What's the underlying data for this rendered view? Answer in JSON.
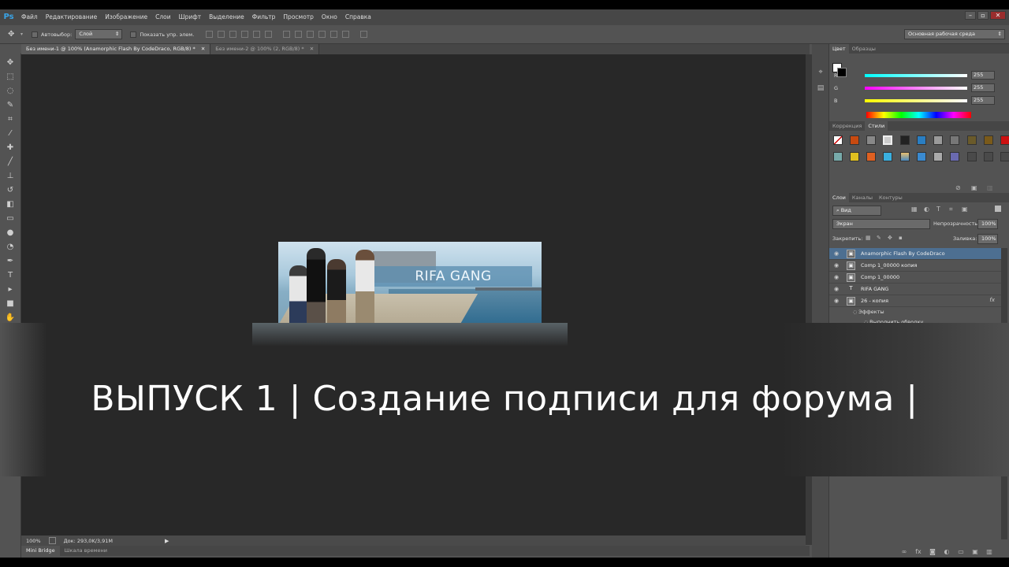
{
  "app": {
    "logo": "Ps",
    "menu": [
      "Файл",
      "Редактирование",
      "Изображение",
      "Слои",
      "Шрифт",
      "Выделение",
      "Фильтр",
      "Просмотр",
      "Окно",
      "Справка"
    ],
    "window_buttons": [
      "–",
      "▫",
      "✕"
    ]
  },
  "options": {
    "autoselect_label": "Автовыбор:",
    "autoselect_value": "Слой",
    "show_controls_label": "Показать упр. элем.",
    "workspace": "Основная рабочая среда"
  },
  "doc_tabs": [
    {
      "label": "Без имени-1 @ 100% (Anamorphic Flash By CodeDraco, RGB/8) *",
      "close": "✕"
    },
    {
      "label": "Без имени-2 @ 100% (2, RGB/8) *",
      "close": "✕"
    }
  ],
  "canvas": {
    "banner_text": "RIFA GANG"
  },
  "overlay": {
    "title": "ВЫПУСК 1 | Создание подписи для форума |"
  },
  "status": {
    "zoom": "100%",
    "doc_info": "Док: 293,0K/3,91M"
  },
  "bottom_tabs": [
    "Mini Bridge",
    "Шкала времени"
  ],
  "color_panel": {
    "tabs": [
      "Цвет",
      "Образцы"
    ],
    "channels": [
      {
        "label": "R",
        "value": "255",
        "gradient": "linear-gradient(90deg,#00ffff,#ffffff)"
      },
      {
        "label": "G",
        "value": "255",
        "gradient": "linear-gradient(90deg,#ff00ff,#ffffff)"
      },
      {
        "label": "B",
        "value": "255",
        "gradient": "linear-gradient(90deg,#ffff00,#ffffff)"
      }
    ]
  },
  "styles_panel": {
    "tabs": [
      "Коррекция",
      "Стили"
    ]
  },
  "layers_panel": {
    "tabs": [
      "Слои",
      "Каналы",
      "Контуры"
    ],
    "filter_label": "Вид",
    "blend_mode": "Экран",
    "opacity_label": "Непрозрачность:",
    "opacity_value": "100%",
    "lock_label": "Закрепить:",
    "fill_label": "Заливка:",
    "fill_value": "100%",
    "layers": [
      {
        "name": "Anamorphic Flash By CodeDraco",
        "thumb": "▣",
        "active": true
      },
      {
        "name": "Comp 1_00000 копия",
        "thumb": "▣",
        "active": false
      },
      {
        "name": "Comp 1_00000",
        "thumb": "▣",
        "active": false
      },
      {
        "name": "RIFA GANG",
        "thumb": "T",
        "active": false
      },
      {
        "name": "26 - копия",
        "thumb": "▣",
        "active": false,
        "fx": "fx"
      }
    ],
    "effects_label": "Эффекты",
    "stroke_label": "Выполнить обводку"
  },
  "colors": {
    "accent": "#4d6f91",
    "ps_blue": "#39a3e6"
  }
}
